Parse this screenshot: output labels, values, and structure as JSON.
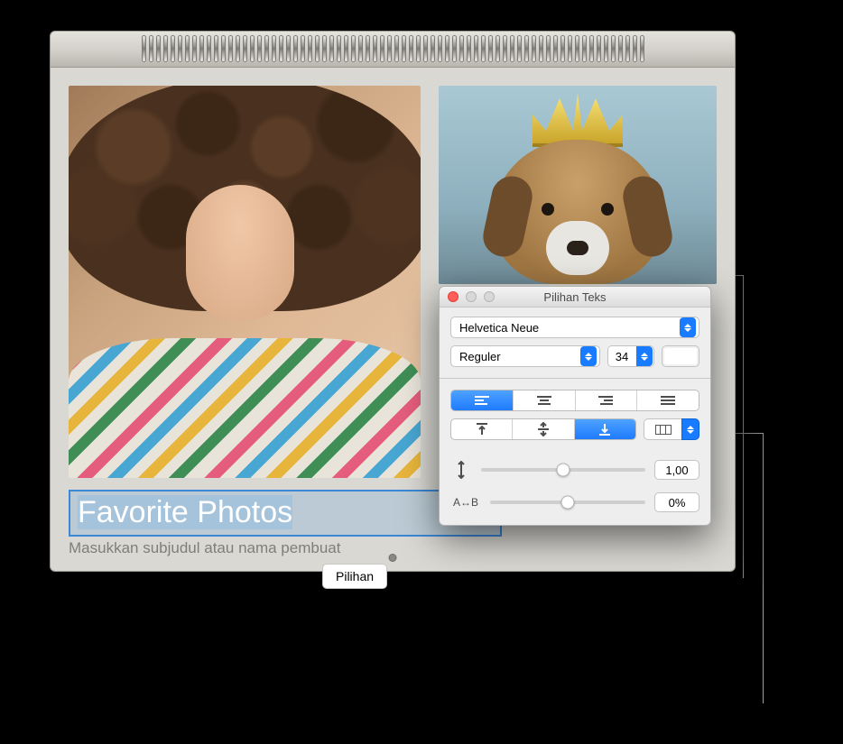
{
  "calendar": {
    "title_text": "Favorite Photos",
    "subtitle_placeholder": "Masukkan subjudul atau nama pembuat",
    "options_button": "Pilihan"
  },
  "panel": {
    "title": "Pilihan Teks",
    "font_family": "Helvetica Neue",
    "font_style": "Reguler",
    "font_size": "34",
    "line_spacing_value": "1,00",
    "tracking_value": "0%",
    "tracking_label": "A↔B"
  }
}
